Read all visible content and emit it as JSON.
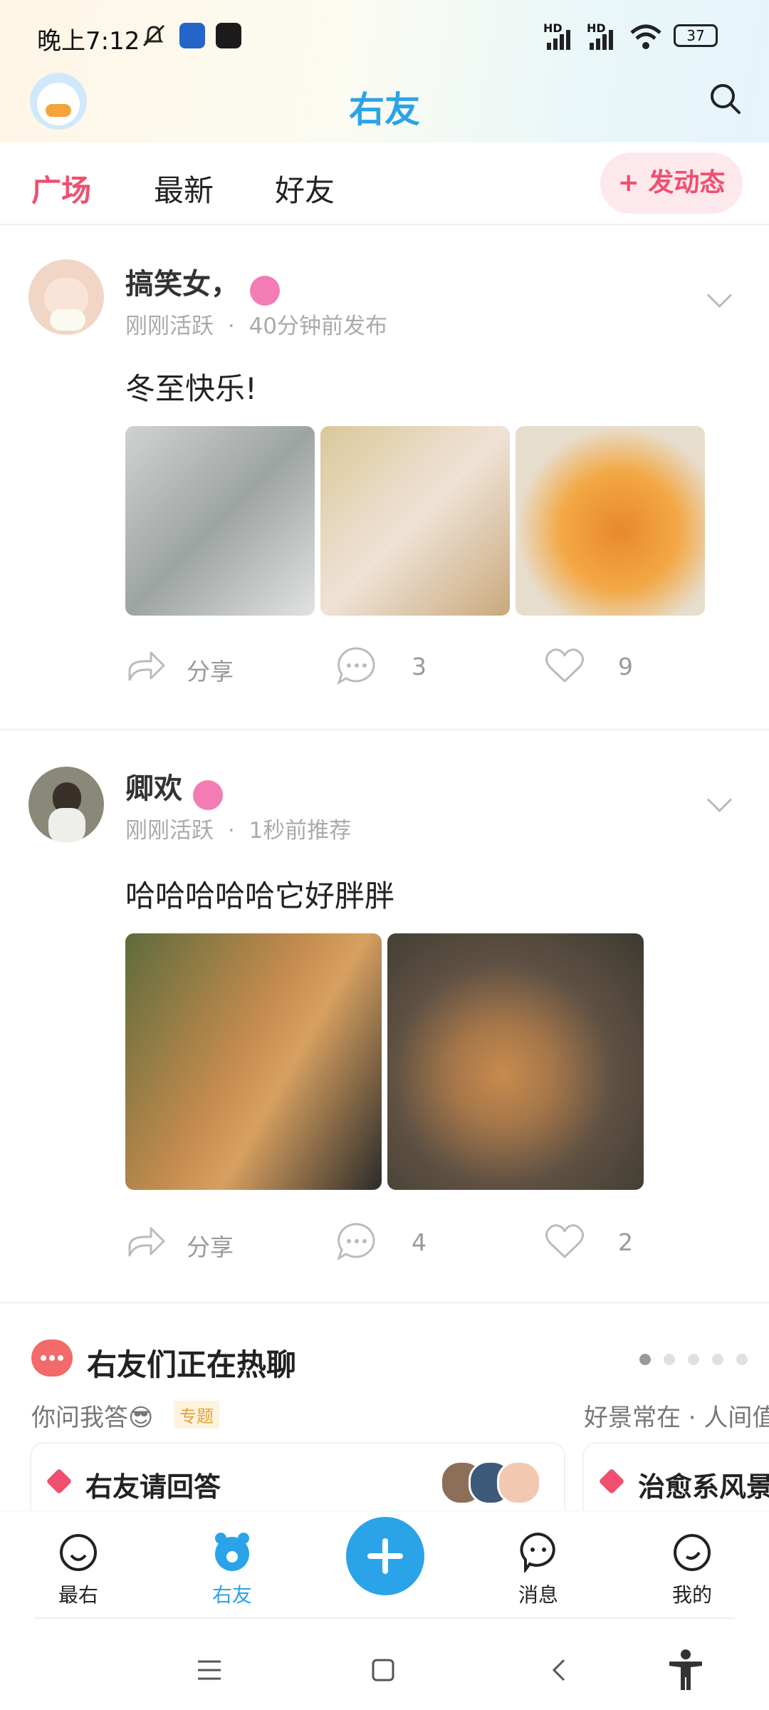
{
  "status_bar": {
    "time": "晚上7:12",
    "battery": "37",
    "signal1": "HD",
    "signal2": "HD"
  },
  "header": {
    "title": "右友"
  },
  "tabs": {
    "items": [
      "广场",
      "最新",
      "好友"
    ],
    "post_button": "+ 发动态"
  },
  "posts": [
    {
      "name": "搞笑女，",
      "status": "刚刚活跃",
      "time": "40分钟前发布",
      "text": "冬至快乐!",
      "share": "分享",
      "comments": "3",
      "likes": "9"
    },
    {
      "name": "卿欢",
      "status": "刚刚活跃",
      "time": "1秒前推荐",
      "text": "哈哈哈哈哈它好胖胖",
      "share": "分享",
      "comments": "4",
      "likes": "2"
    }
  ],
  "hot": {
    "title": "右友们正在热聊",
    "topic1": "你问我答😎",
    "topic1_badge": "专题",
    "topic2": "好景常在 · 人间值",
    "card1_title": "右友请回答",
    "card2_title": "治愈系风景"
  },
  "nav": {
    "items": [
      "最右",
      "右友",
      "消息",
      "我的"
    ]
  },
  "colors": {
    "accent_blue": "#2aa3e8",
    "accent_pink": "#f04f6f"
  }
}
